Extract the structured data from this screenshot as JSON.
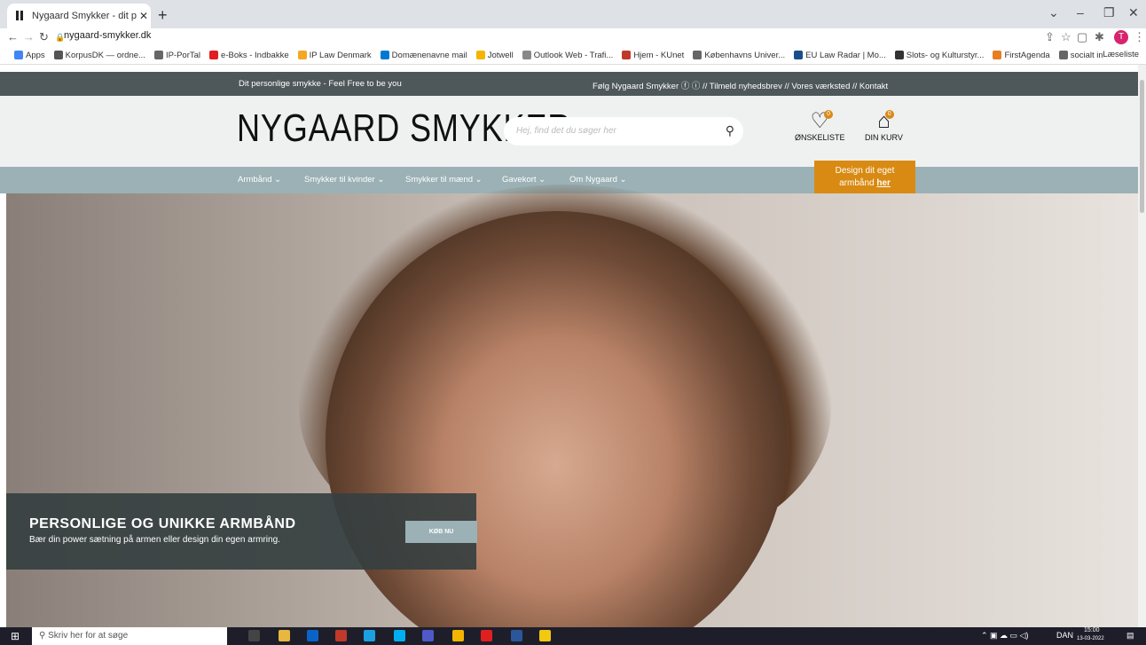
{
  "browser": {
    "tab_title": "Nygaard Smykker - dit personlig",
    "url": "nygaard-smykker.dk",
    "bookmarks": [
      {
        "label": "Apps",
        "color": "#4285f4"
      },
      {
        "label": "KorpusDK — ordne...",
        "color": "#555"
      },
      {
        "label": "IP-PorTal",
        "color": "#666"
      },
      {
        "label": "e-Boks - Indbakke",
        "color": "#e31b23"
      },
      {
        "label": "IP Law Denmark",
        "color": "#f5a623"
      },
      {
        "label": "Domænenavne mail",
        "color": "#0078d4"
      },
      {
        "label": "Jotwell",
        "color": "#f5b400"
      },
      {
        "label": "Outlook Web - Trafi...",
        "color": "#888"
      },
      {
        "label": "Hjem - KUnet",
        "color": "#c0392b"
      },
      {
        "label": "Københavns Univer...",
        "color": "#666"
      },
      {
        "label": "EU Law Radar | Mo...",
        "color": "#1a4e8a"
      },
      {
        "label": "Slots- og Kulturstyr...",
        "color": "#333"
      },
      {
        "label": "FirstAgenda",
        "color": "#e67e22"
      },
      {
        "label": "socialt indblik",
        "color": "#666"
      }
    ],
    "reading_list": "Læseliste",
    "profile_initial": "T"
  },
  "site": {
    "top_left": "Dit personlige smykke - Feel Free to be you",
    "top_right": "Følg Nygaard Smykker  ⓕ  ⓘ // Tilmeld nyhedsbrev // Vores værksted // Kontakt",
    "logo": "NYGAARD SMYKKER",
    "search_placeholder": "Hej, find det du søger her",
    "wishlist_label": "ØNSKELISTE",
    "wishlist_count": "0",
    "cart_label": "DIN KURV",
    "cart_count": "0",
    "menu": [
      "Armbånd ⌄",
      "Smykker til kvinder ⌄",
      "Smykker til mænd ⌄",
      "Gavekort ⌄",
      "Om Nygaard ⌄"
    ],
    "design_line1": "Design dit eget",
    "design_line2": "armbånd ",
    "design_link": "her",
    "promo_title": "PERSONLIGE OG UNIKKE ARMBÅND",
    "promo_text": "Bær din power sætning på armen eller design din egen armring.",
    "buy_label": "KØB NU"
  },
  "taskbar": {
    "search": "Skriv her for at søge",
    "lang": "DAN",
    "time": "15:00",
    "date": "13-03-2022"
  }
}
